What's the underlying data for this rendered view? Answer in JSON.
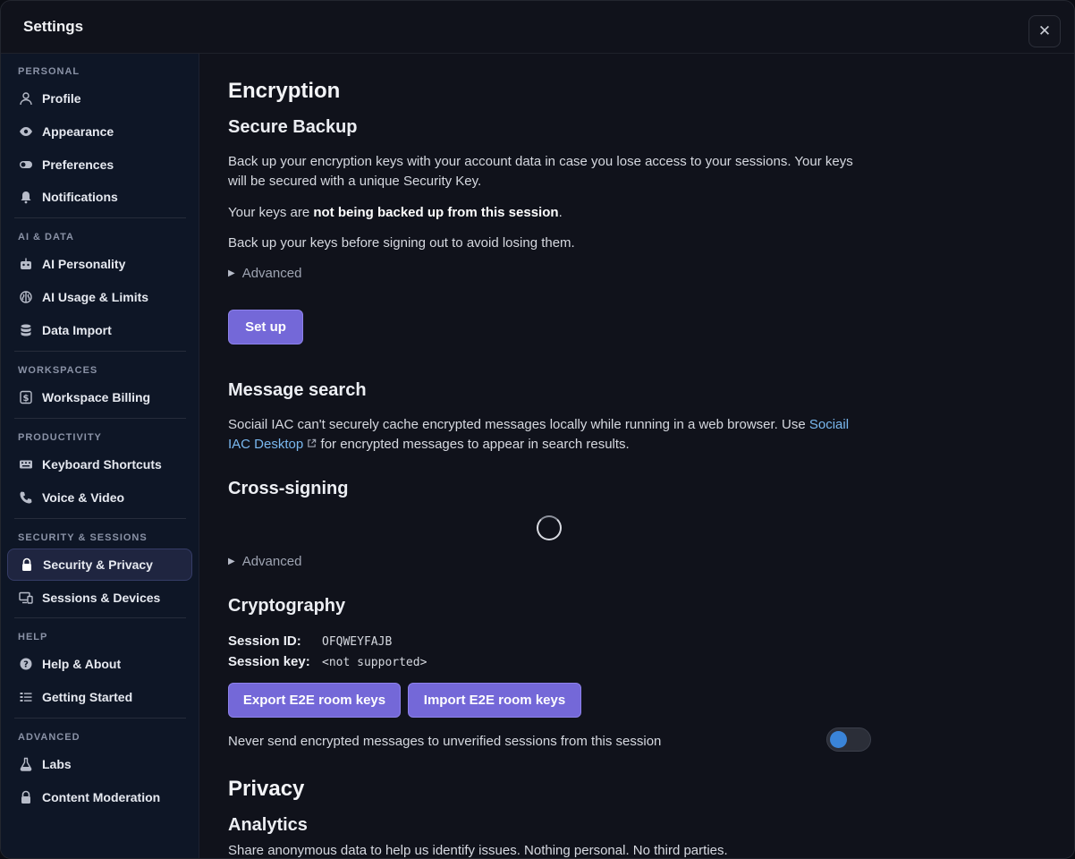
{
  "window": {
    "title": "Settings",
    "close_icon": "close-icon"
  },
  "sidebar": {
    "sections": [
      {
        "label": "PERSONAL",
        "items": [
          {
            "label": "Profile",
            "icon": "user-icon"
          },
          {
            "label": "Appearance",
            "icon": "eye-icon"
          },
          {
            "label": "Preferences",
            "icon": "toggle-icon"
          },
          {
            "label": "Notifications",
            "icon": "bell-icon"
          }
        ]
      },
      {
        "label": "AI & DATA",
        "items": [
          {
            "label": "AI Personality",
            "icon": "robot-icon"
          },
          {
            "label": "AI Usage & Limits",
            "icon": "brain-icon"
          },
          {
            "label": "Data Import",
            "icon": "database-icon"
          }
        ]
      },
      {
        "label": "WORKSPACES",
        "items": [
          {
            "label": "Workspace Billing",
            "icon": "dollar-icon"
          }
        ]
      },
      {
        "label": "PRODUCTIVITY",
        "items": [
          {
            "label": "Keyboard Shortcuts",
            "icon": "keyboard-icon"
          },
          {
            "label": "Voice & Video",
            "icon": "phone-icon"
          }
        ]
      },
      {
        "label": "SECURITY & SESSIONS",
        "items": [
          {
            "label": "Security & Privacy",
            "icon": "lock-icon",
            "active": true
          },
          {
            "label": "Sessions & Devices",
            "icon": "devices-icon"
          }
        ]
      },
      {
        "label": "HELP",
        "items": [
          {
            "label": "Help & About",
            "icon": "help-icon"
          },
          {
            "label": "Getting Started",
            "icon": "checklist-icon"
          }
        ]
      },
      {
        "label": "ADVANCED",
        "items": [
          {
            "label": "Labs",
            "icon": "flask-icon"
          },
          {
            "label": "Content Moderation",
            "icon": "lock-icon"
          }
        ]
      }
    ]
  },
  "main": {
    "encryption_title": "Encryption",
    "secure_backup": {
      "title": "Secure Backup",
      "desc": "Back up your encryption keys with your account data in case you lose access to your sessions. Your keys will be secured with a unique Security Key.",
      "status_prefix": "Your keys are ",
      "status_bold": "not being backed up from this session",
      "status_suffix": ".",
      "warning": "Back up your keys before signing out to avoid losing them.",
      "advanced": "Advanced",
      "setup_button": "Set up"
    },
    "message_search": {
      "title": "Message search",
      "desc_prefix": "Sociail IAC can't securely cache encrypted messages locally while running in a web browser. Use ",
      "link": "Sociail IAC Desktop",
      "desc_suffix": " for encrypted messages to appear in search results."
    },
    "cross_signing": {
      "title": "Cross-signing",
      "advanced": "Advanced"
    },
    "cryptography": {
      "title": "Cryptography",
      "session_id_label": "Session ID:",
      "session_id": "OFQWEYFAJB",
      "session_key_label": "Session key:",
      "session_key": "<not supported>",
      "export_button": "Export E2E room keys",
      "import_button": "Import E2E room keys",
      "never_send_label": "Never send encrypted messages to unverified sessions from this session",
      "never_send_enabled": false
    },
    "privacy_title": "Privacy",
    "analytics": {
      "title": "Analytics",
      "desc": "Share anonymous data to help us identify issues. Nothing personal. No third parties."
    }
  }
}
